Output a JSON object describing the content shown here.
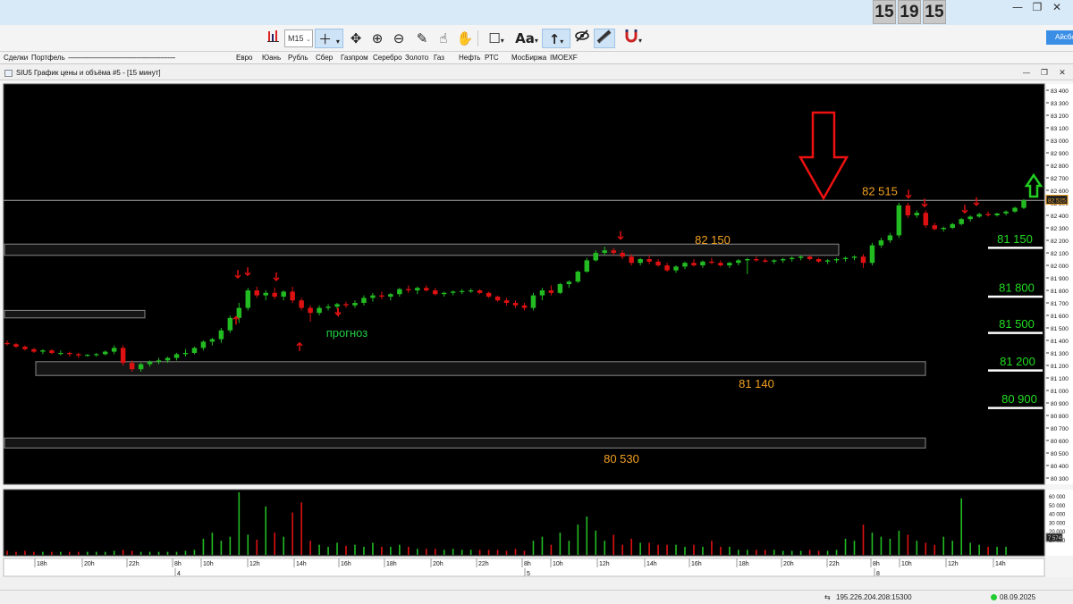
{
  "titlebar": {
    "clock": [
      "15",
      "19",
      "15"
    ],
    "minimize": "—",
    "restore": "❐",
    "close": "✕"
  },
  "toolbar": {
    "timeframe": "M15",
    "right_button": "Айсберг"
  },
  "tabs": [
    "Сделки",
    "Портфель",
    "----------------------------------------------------------",
    "Евро",
    "Юань",
    "Рубль",
    "Сбер",
    "Газпром",
    "Серебро",
    "Золото",
    "Газ",
    "Нефть",
    "РТС",
    "МосБиржа",
    "IMOEXF"
  ],
  "window": {
    "title": "SIU5 График цены и объёма #5 - [15 минут]",
    "minimize": "—",
    "restore": "❐",
    "close": "✕"
  },
  "status": {
    "server": "195.226.204.208:15300",
    "date": "08.09.2025"
  },
  "colors": {
    "up": "#22bb22",
    "down": "#dd1111",
    "label": "#f0a020",
    "forecast": "#22cc44",
    "level_text": "#22dd22",
    "big_arrow": "#ee1111",
    "green_arrow": "#22cc22"
  },
  "chart_data": {
    "type": "candlestick",
    "symbol": "SIU5",
    "timeframe": "15 минут",
    "ylim": [
      80250,
      83450
    ],
    "y_ticks": [
      "83 400",
      "83 300",
      "83 200",
      "83 100",
      "83 000",
      "82 900",
      "82 800",
      "82 700",
      "82 600",
      "82 500",
      "82 400",
      "82 300",
      "82 200",
      "82 100",
      "82 000",
      "81 900",
      "81 800",
      "81 700",
      "81 600",
      "81 500",
      "81 400",
      "81 300",
      "81 200",
      "81 100",
      "81 000",
      "80 900",
      "80 800",
      "80 700",
      "80 600",
      "80 500",
      "80 400",
      "80 300"
    ],
    "current_price": "82 525",
    "x_labels": [
      "18h",
      "20h",
      "22h",
      "8h",
      "10h",
      "12h",
      "14h",
      "16h",
      "18h",
      "20h",
      "22h",
      "8h",
      "10h",
      "12h",
      "14h",
      "16h",
      "18h",
      "20h",
      "22h",
      "8h",
      "10h",
      "12h",
      "14h"
    ],
    "day_labels": [
      "4",
      "5",
      "8"
    ],
    "volume_ticks": [
      "60 000",
      "50 000",
      "40 000",
      "30 000",
      "20 000",
      "10 000"
    ],
    "current_volume": "7 574",
    "candles": [
      [
        81380,
        81400,
        81360,
        81370
      ],
      [
        81370,
        81380,
        81340,
        81350
      ],
      [
        81350,
        81360,
        81320,
        81330
      ],
      [
        81330,
        81340,
        81300,
        81310
      ],
      [
        81310,
        81330,
        81290,
        81320
      ],
      [
        81320,
        81330,
        81290,
        81300
      ],
      [
        81300,
        81320,
        81280,
        81300
      ],
      [
        81300,
        81310,
        81270,
        81290
      ],
      [
        81290,
        81300,
        81260,
        81280
      ],
      [
        81280,
        81290,
        81270,
        81285
      ],
      [
        81285,
        81300,
        81270,
        81290
      ],
      [
        81290,
        81320,
        81280,
        81310
      ],
      [
        81310,
        81360,
        81290,
        81340
      ],
      [
        81340,
        81360,
        81200,
        81220
      ],
      [
        81220,
        81240,
        81150,
        81170
      ],
      [
        81170,
        81220,
        81150,
        81210
      ],
      [
        81210,
        81240,
        81190,
        81230
      ],
      [
        81230,
        81260,
        81210,
        81240
      ],
      [
        81240,
        81270,
        81220,
        81260
      ],
      [
        81260,
        81300,
        81240,
        81290
      ],
      [
        81290,
        81330,
        81270,
        81300
      ],
      [
        81300,
        81350,
        81290,
        81340
      ],
      [
        81340,
        81400,
        81320,
        81390
      ],
      [
        81390,
        81420,
        81360,
        81410
      ],
      [
        81410,
        81500,
        81380,
        81480
      ],
      [
        81480,
        81600,
        81460,
        81580
      ],
      [
        81580,
        81700,
        81540,
        81660
      ],
      [
        81660,
        81820,
        81640,
        81800
      ],
      [
        81800,
        81830,
        81740,
        81760
      ],
      [
        81760,
        81800,
        81720,
        81780
      ],
      [
        81780,
        81820,
        81730,
        81750
      ],
      [
        81750,
        81800,
        81720,
        81790
      ],
      [
        81790,
        81830,
        81700,
        81720
      ],
      [
        81720,
        81740,
        81640,
        81660
      ],
      [
        81660,
        81680,
        81550,
        81620
      ],
      [
        81620,
        81680,
        81600,
        81660
      ],
      [
        81660,
        81690,
        81640,
        81670
      ],
      [
        81670,
        81700,
        81650,
        81690
      ],
      [
        81690,
        81710,
        81660,
        81680
      ],
      [
        81680,
        81720,
        81660,
        81700
      ],
      [
        81700,
        81760,
        81680,
        81740
      ],
      [
        81740,
        81780,
        81710,
        81760
      ],
      [
        81760,
        81790,
        81730,
        81750
      ],
      [
        81750,
        81780,
        81720,
        81770
      ],
      [
        81770,
        81820,
        81750,
        81810
      ],
      [
        81810,
        81840,
        81780,
        81800
      ],
      [
        81800,
        81830,
        81770,
        81820
      ],
      [
        81820,
        81840,
        81790,
        81800
      ],
      [
        81800,
        81820,
        81760,
        81770
      ],
      [
        81770,
        81790,
        81750,
        81780
      ],
      [
        81780,
        81800,
        81760,
        81790
      ],
      [
        81790,
        81810,
        81770,
        81795
      ],
      [
        81795,
        81815,
        81780,
        81800
      ],
      [
        81800,
        81810,
        81770,
        81780
      ],
      [
        81780,
        81790,
        81740,
        81750
      ],
      [
        81750,
        81760,
        81710,
        81720
      ],
      [
        81720,
        81740,
        81680,
        81700
      ],
      [
        81700,
        81720,
        81660,
        81680
      ],
      [
        81680,
        81700,
        81640,
        81660
      ],
      [
        81660,
        81780,
        81640,
        81760
      ],
      [
        81760,
        81820,
        81720,
        81800
      ],
      [
        81800,
        81840,
        81760,
        81780
      ],
      [
        81780,
        81860,
        81770,
        81850
      ],
      [
        81850,
        81880,
        81820,
        81870
      ],
      [
        81870,
        81960,
        81860,
        81950
      ],
      [
        81950,
        82060,
        81940,
        82040
      ],
      [
        82040,
        82120,
        82030,
        82100
      ],
      [
        82100,
        82150,
        82080,
        82120
      ],
      [
        82120,
        82140,
        82080,
        82100
      ],
      [
        82100,
        82120,
        82050,
        82070
      ],
      [
        82070,
        82090,
        82000,
        82020
      ],
      [
        82020,
        82060,
        82000,
        82050
      ],
      [
        82050,
        82080,
        82010,
        82030
      ],
      [
        82030,
        82050,
        81990,
        82000
      ],
      [
        82000,
        82020,
        81950,
        81960
      ],
      [
        81960,
        82000,
        81940,
        81990
      ],
      [
        81990,
        82030,
        81970,
        82020
      ],
      [
        82020,
        82050,
        81990,
        82000
      ],
      [
        82000,
        82040,
        81980,
        82030
      ],
      [
        82030,
        82060,
        82010,
        82020
      ],
      [
        82020,
        82040,
        81990,
        82000
      ],
      [
        82000,
        82030,
        81980,
        82020
      ],
      [
        82020,
        82050,
        82000,
        82040
      ],
      [
        82040,
        82060,
        81930,
        82050
      ],
      [
        82050,
        82070,
        82030,
        82040
      ],
      [
        82040,
        82060,
        82020,
        82030
      ],
      [
        82030,
        82050,
        82010,
        82040
      ],
      [
        82040,
        82060,
        82020,
        82050
      ],
      [
        82050,
        82070,
        82030,
        82060
      ],
      [
        82060,
        82080,
        82040,
        82070
      ],
      [
        82070,
        82080,
        82040,
        82050
      ],
      [
        82050,
        82060,
        82020,
        82030
      ],
      [
        82030,
        82050,
        82010,
        82040
      ],
      [
        82040,
        82060,
        82020,
        82050
      ],
      [
        82050,
        82070,
        82030,
        82060
      ],
      [
        82060,
        82080,
        82040,
        82070
      ],
      [
        82070,
        82090,
        81980,
        82020
      ],
      [
        82020,
        82180,
        82000,
        82160
      ],
      [
        82160,
        82220,
        82140,
        82200
      ],
      [
        82200,
        82260,
        82180,
        82240
      ],
      [
        82240,
        82500,
        82220,
        82480
      ],
      [
        82480,
        82500,
        82380,
        82400
      ],
      [
        82400,
        82440,
        82380,
        82420
      ],
      [
        82420,
        82440,
        82300,
        82320
      ],
      [
        82320,
        82340,
        82280,
        82290
      ],
      [
        82290,
        82310,
        82270,
        82300
      ],
      [
        82300,
        82340,
        82290,
        82330
      ],
      [
        82330,
        82380,
        82320,
        82370
      ],
      [
        82370,
        82400,
        82350,
        82390
      ],
      [
        82390,
        82420,
        82380,
        82410
      ],
      [
        82410,
        82430,
        82390,
        82400
      ],
      [
        82400,
        82420,
        82390,
        82415
      ],
      [
        82415,
        82440,
        82400,
        82430
      ],
      [
        82430,
        82470,
        82420,
        82460
      ],
      [
        82460,
        82530,
        82450,
        82520
      ]
    ],
    "volumes": [
      4,
      3,
      4,
      3,
      3,
      3,
      3,
      3,
      3,
      3,
      3,
      3,
      4,
      5,
      4,
      3,
      3,
      3,
      3,
      3,
      4,
      5,
      16,
      22,
      14,
      18,
      62,
      20,
      15,
      48,
      22,
      18,
      42,
      52,
      14,
      10,
      8,
      12,
      9,
      10,
      8,
      12,
      8,
      8,
      10,
      8,
      6,
      6,
      6,
      5,
      6,
      5,
      5,
      5,
      5,
      5,
      4,
      6,
      4,
      14,
      18,
      10,
      22,
      14,
      30,
      38,
      24,
      14,
      20,
      10,
      16,
      12,
      12,
      10,
      10,
      10,
      8,
      10,
      8,
      14,
      8,
      8,
      5,
      5,
      5,
      5,
      5,
      4,
      4,
      4,
      5,
      4,
      4,
      5,
      16,
      14,
      30,
      22,
      18,
      16,
      24,
      20,
      14,
      12,
      10,
      18,
      14,
      56,
      12,
      10,
      8,
      8,
      8
    ]
  },
  "annotations": {
    "zones": [
      {
        "label": "82 150"
      },
      {
        "label": ""
      },
      {
        "label": "81 140"
      },
      {
        "label": "80 530"
      }
    ],
    "resistance_label": "82 515",
    "forecast_label": "прогноз",
    "target_levels": [
      "81 150",
      "81 800",
      "81 500",
      "81 200",
      "80 900"
    ]
  }
}
